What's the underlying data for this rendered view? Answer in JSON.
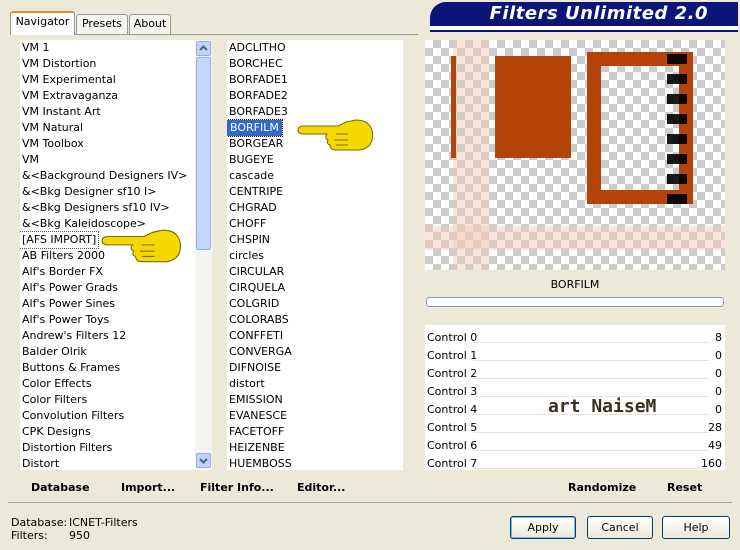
{
  "tabs": [
    {
      "label": "Navigator"
    },
    {
      "label": "Presets"
    },
    {
      "label": "About"
    }
  ],
  "header": {
    "title": "Filters Unlimited 2.0"
  },
  "categories": [
    "VM 1",
    "VM Distortion",
    "VM Experimental",
    "VM Extravaganza",
    "VM Instant Art",
    "VM Natural",
    "VM Toolbox",
    "VM",
    "&<Background Designers IV>",
    "&<Bkg Designer sf10 I>",
    "&<Bkg Designers sf10 IV>",
    "&<Bkg Kaleidoscope>",
    "[AFS IMPORT]",
    "AB Filters 2000",
    "Alf's Border FX",
    "Alf's Power Grads",
    "Alf's Power Sines",
    "Alf's Power Toys",
    "Andrew's Filters 12",
    "Balder Olrik",
    "Buttons & Frames",
    "Color Effects",
    "Color Filters",
    "Convolution Filters",
    "CPK Designs",
    "Distortion Filters",
    "Distort"
  ],
  "filters": [
    "ADCLITHO",
    "BORCHEC",
    "BORFADE1",
    "BORFADE2",
    "BORFADE3",
    "BORFILM",
    "BORGEAR",
    "BUGEYE",
    "cascade",
    "CENTRIPE",
    "CHGRAD",
    "CHOFF",
    "CHSPIN",
    "circles",
    "CIRCULAR",
    "CIRQUELA",
    "COLGRID",
    "COLORABS",
    "CONFFETI",
    "CONVERGA",
    "DIFNOISE",
    "distort",
    "EMISSION",
    "EVANESCE",
    "FACETOFF",
    "HEIZENBE",
    "HUEMBOSS"
  ],
  "selected_filter_label": "BORFILM",
  "controls": [
    {
      "label": "Control 0",
      "value": "8"
    },
    {
      "label": "Control 1",
      "value": "0"
    },
    {
      "label": "Control 2",
      "value": "0"
    },
    {
      "label": "Control 3",
      "value": "0"
    },
    {
      "label": "Control 4",
      "value": "0"
    },
    {
      "label": "Control 5",
      "value": "28"
    },
    {
      "label": "Control 6",
      "value": "49"
    },
    {
      "label": "Control 7",
      "value": "160"
    }
  ],
  "watermark": "art NaiseM",
  "toolbar": {
    "database": "Database",
    "import": "Import...",
    "filter_info": "Filter Info...",
    "editor": "Editor...",
    "randomize": "Randomize",
    "reset": "Reset"
  },
  "status": {
    "database_label": "Database:",
    "database_value": "ICNET-Filters",
    "filters_label": "Filters:",
    "filters_value": "950"
  },
  "buttons": {
    "apply": "Apply",
    "cancel": "Cancel",
    "help": "Help"
  },
  "colors": {
    "banner": "#0b1479",
    "preview_frame": "#b34308",
    "selection": "#316ac5",
    "pointer_hand": "#f5d800"
  }
}
